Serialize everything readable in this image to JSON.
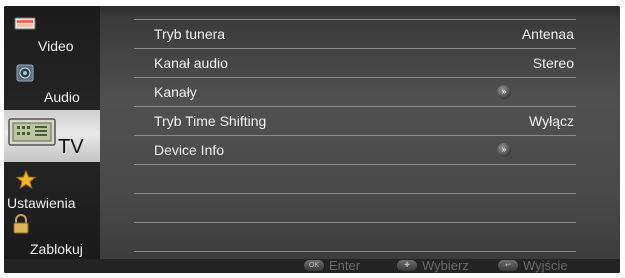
{
  "sidebar": {
    "items": [
      {
        "label": "Video",
        "icon": "video-monitor-icon"
      },
      {
        "label": "Audio",
        "icon": "audio-speaker-icon"
      },
      {
        "label": "TV",
        "icon": "tv-tuner-icon",
        "active": true
      },
      {
        "label": "Ustawienia",
        "icon": "star-settings-icon"
      },
      {
        "label": "Zablokuj",
        "icon": "padlock-icon"
      }
    ]
  },
  "menu": {
    "rows": [
      {
        "name": "Tryb tunera",
        "value": "Antenaa"
      },
      {
        "name": "Kanał audio",
        "value": "Stereo"
      },
      {
        "name": "Kanały",
        "value": ""
      },
      {
        "name": "Tryb Time Shifting",
        "value": "Wyłącz"
      },
      {
        "name": "Device Info",
        "value": ""
      }
    ]
  },
  "footer": {
    "enter_icon": "OK",
    "enter_label": "Enter",
    "select_label": "Wybierz",
    "exit_label": "Wyjście"
  },
  "colors": {
    "menu_text": "#f4f4f4",
    "active_tab": "#e0e0e0",
    "footer_text": "#6a6a6a"
  }
}
